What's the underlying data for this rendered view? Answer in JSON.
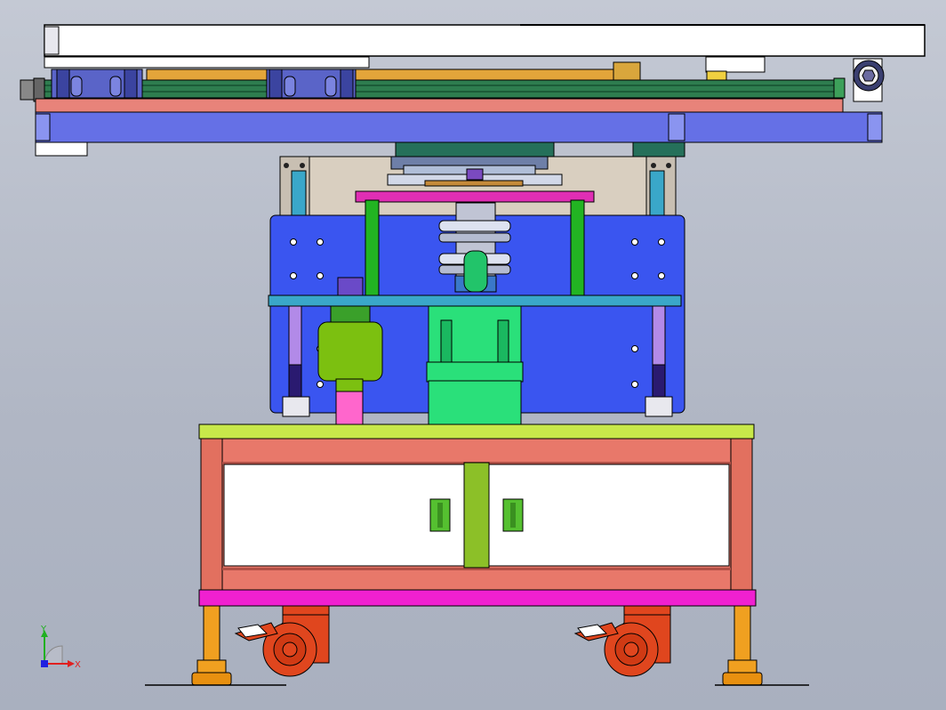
{
  "view": {
    "background_top": "#c4c9d4",
    "background_bottom": "#a9b0bf"
  },
  "triad": {
    "x_label": "X",
    "y_label": "Y",
    "x_color": "#e02020",
    "y_color": "#20b020",
    "z_color": "#2020e0"
  },
  "colors": {
    "top_rail": "#ffffff",
    "slide_green": "#2e7d4f",
    "bearing_block": "#5a64c8",
    "salmon_beam": "#e8837a",
    "blue_beam": "#6570e6",
    "frame_tan": "#d9cfc0",
    "blue_panel": "#3a55f0",
    "green_post": "#22b422",
    "magenta_bar": "#e02eb4",
    "cyan_plate": "#3aa7c9",
    "motor_green": "#2ae07a",
    "reducer_olive": "#7cc010",
    "lime_top": "#c8e84a",
    "cabinet_salmon": "#e8786a",
    "door_white": "#ffffff",
    "handle_green": "#55c030",
    "base_magenta": "#f020d0",
    "leg_orange": "#f0a020",
    "caster_red": "#e0461e",
    "pink_coupler": "#ff66cc"
  }
}
